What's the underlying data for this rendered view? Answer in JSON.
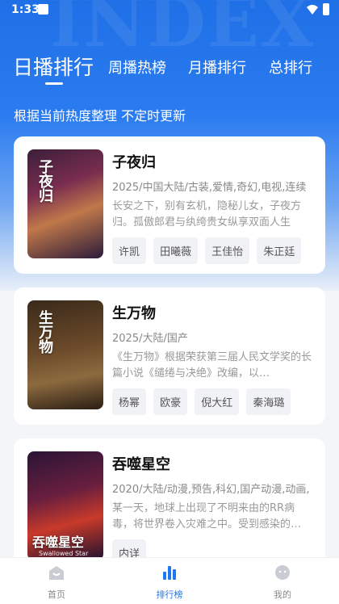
{
  "status": {
    "time": "1:33"
  },
  "hero": {
    "deco_text": "INDEX"
  },
  "tabs": [
    {
      "label": "日播排行",
      "active": true
    },
    {
      "label": "周播热榜",
      "active": false
    },
    {
      "label": "月播排行",
      "active": false
    },
    {
      "label": "总排行",
      "active": false
    }
  ],
  "subtitle": "根据当前热度整理 不定时更新",
  "items": [
    {
      "title": "子夜归",
      "meta": "2025/中国大陆/古装,爱情,奇幻,电视,连续",
      "desc": "长安之下，别有玄机，隐秘儿女，子夜方归。孤傲郎君与纨绔贵女纵享双面人生",
      "actors": [
        "许凯",
        "田曦薇",
        "王佳怡",
        "朱正廷"
      ],
      "poster_text": "子夜归"
    },
    {
      "title": "生万物",
      "meta": "2025/大陆/国产",
      "desc": "《生万物》根据荣获第三届人民文学奖的长篇小说《缱绻与决绝》改编，以…",
      "actors": [
        "杨幂",
        "欧豪",
        "倪大红",
        "秦海璐"
      ],
      "poster_text": "生万物"
    },
    {
      "title": "吞噬星空",
      "meta": "2020/大陆/动漫,预告,科幻,国产动漫,动画,",
      "desc": "某一天，地球上出现了不明来由的RR病毒，将世界卷入灾难之中。受到感染的…",
      "actors": [
        "内详"
      ],
      "poster_text": "吞噬星空",
      "poster_sub": "Swallowed Star"
    }
  ],
  "nav": [
    {
      "label": "首页",
      "icon": "home-icon",
      "active": false
    },
    {
      "label": "排行榜",
      "icon": "chart-icon",
      "active": true
    },
    {
      "label": "我的",
      "icon": "user-icon",
      "active": false
    }
  ],
  "colors": {
    "accent": "#1e78ef",
    "hero_top": "#1f6fe6"
  }
}
